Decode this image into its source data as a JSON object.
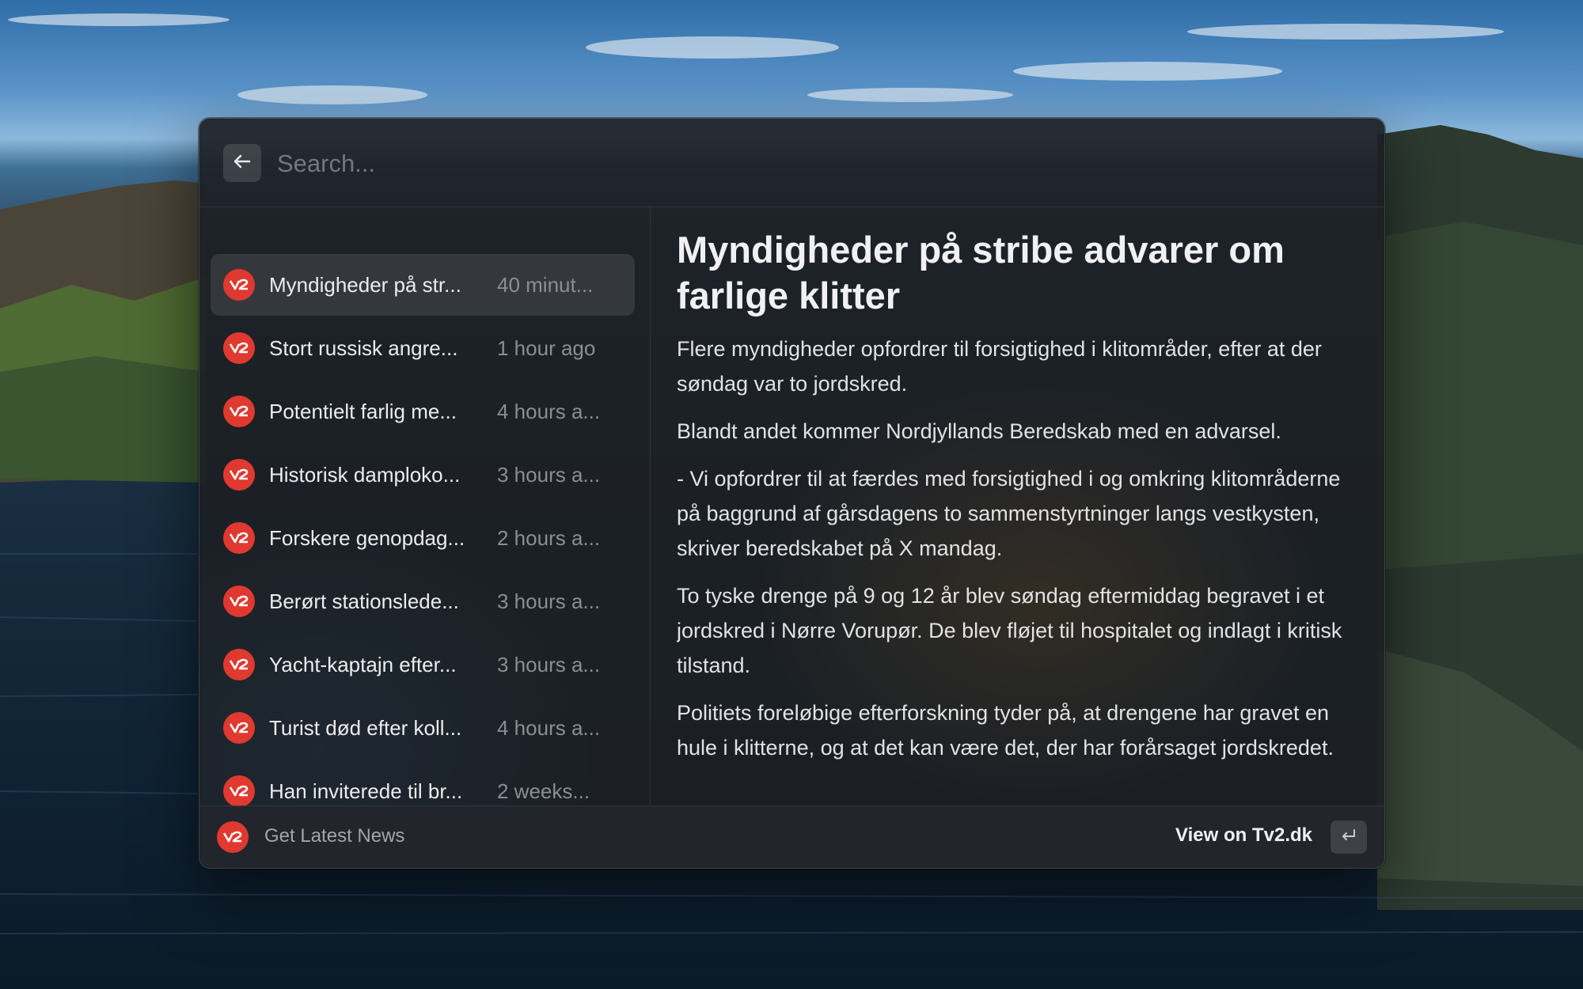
{
  "search": {
    "placeholder": "Search..."
  },
  "news": [
    {
      "title": "Myndigheder på str...",
      "time": "40 minut..."
    },
    {
      "title": "Stort russisk angre...",
      "time": "1 hour ago"
    },
    {
      "title": "Potentielt farlig me...",
      "time": "4 hours a..."
    },
    {
      "title": "Historisk damploko...",
      "time": "3 hours a..."
    },
    {
      "title": "Forskere genopdag...",
      "time": "2 hours a..."
    },
    {
      "title": "Berørt stationslede...",
      "time": "3 hours a..."
    },
    {
      "title": "Yacht-kaptajn efter...",
      "time": "3 hours a..."
    },
    {
      "title": "Turist død efter koll...",
      "time": "4 hours a..."
    },
    {
      "title": "Han inviterede til br...",
      "time": "2 weeks..."
    }
  ],
  "detail": {
    "headline": "Myndigheder på stribe advarer om farlige klitter",
    "paragraphs": [
      "Flere myndigheder opfordrer til forsigtighed i klitområder, efter at der søndag var to jordskred.",
      "Blandt andet kommer Nordjyllands Beredskab med en advarsel.",
      "- Vi opfordrer til at færdes med forsigtighed i og omkring klitområderne på baggrund af gårsdagens to sammenstyrtninger langs vestkysten, skriver beredskabet på X mandag.",
      "To tyske drenge på 9 og 12 år blev søndag eftermiddag begravet i et jordskred i Nørre Vorupør. De blev fløjet til hospitalet og indlagt i kritisk tilstand.",
      "Politiets foreløbige efterforskning tyder på, at drengene har gravet en hule i klitterne, og at det kan være det, der har forårsaget jordskredet."
    ]
  },
  "footer": {
    "command_title": "Get Latest News",
    "primary_action": "View on Tv2.dk"
  },
  "colors": {
    "tv2_red": "#e0392f",
    "window_bg": "#1c1f24"
  },
  "icons": {
    "back": "arrow-left-icon",
    "source": "tv2-logo-icon",
    "enter": "return-key-icon"
  }
}
